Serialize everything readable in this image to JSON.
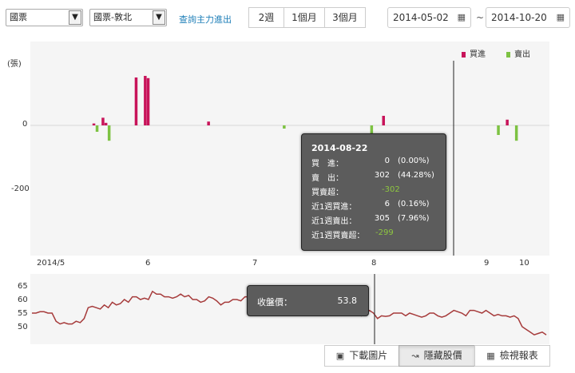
{
  "controls": {
    "market_select": "國票",
    "branch_select": "國票-敦北",
    "query_link": "查詢主力進出",
    "ranges": [
      "2週",
      "1個月",
      "3個月"
    ],
    "start_date": "2014-05-02",
    "end_date": "2014-10-20",
    "tilde": "~"
  },
  "chart_data": [
    {
      "type": "bar",
      "ylabel": "(張)",
      "ylim": [
        -350,
        90
      ],
      "yticks": [
        0,
        -200
      ],
      "xticks": [
        "2014/5",
        "6",
        "7",
        "8",
        "9",
        "10"
      ],
      "legend": {
        "position": "top-right",
        "items": [
          {
            "name": "買進",
            "color": "#c8145a"
          },
          {
            "name": "賣出",
            "color": "#7dc242"
          }
        ]
      },
      "series": [
        {
          "name": "買進",
          "color": "#c8145a",
          "values": [
            {
              "x": "2014-05-23",
              "y": 6
            },
            {
              "x": "2014-05-26",
              "y": 24
            },
            {
              "x": "2014-05-27",
              "y": 8
            },
            {
              "x": "2014-06-06",
              "y": 150
            },
            {
              "x": "2014-06-09",
              "y": 155
            },
            {
              "x": "2014-06-10",
              "y": 148
            },
            {
              "x": "2014-06-30",
              "y": 12
            },
            {
              "x": "2014-08-27",
              "y": 30
            },
            {
              "x": "2014-10-07",
              "y": 18
            }
          ]
        },
        {
          "name": "賣出",
          "color": "#7dc242",
          "values": [
            {
              "x": "2014-05-23",
              "y": -20
            },
            {
              "x": "2014-05-27",
              "y": -48
            },
            {
              "x": "2014-07-24",
              "y": -10
            },
            {
              "x": "2014-08-22",
              "y": -302
            },
            {
              "x": "2014-10-03",
              "y": -30
            },
            {
              "x": "2014-10-09",
              "y": -48
            }
          ]
        }
      ]
    },
    {
      "type": "line",
      "yticks": [
        65,
        60,
        55,
        50
      ],
      "ylim": [
        46,
        67
      ],
      "series": [
        {
          "name": "收盤價",
          "color": "#a63b3b",
          "values": [
            55,
            55,
            55.5,
            55.5,
            55,
            55,
            52,
            51,
            51.5,
            51,
            51,
            52,
            51.5,
            53,
            57,
            57.5,
            57,
            56.5,
            58,
            57,
            59,
            58,
            58.5,
            60,
            59,
            61,
            61,
            60,
            60.5,
            60,
            63,
            62,
            62,
            61,
            61,
            60.5,
            61,
            62,
            61,
            61.5,
            60,
            60,
            59,
            59.5,
            61,
            60.5,
            59.5,
            58,
            59,
            59,
            60,
            60,
            59.5,
            61,
            61,
            61,
            60,
            60,
            61,
            61,
            60,
            59,
            61,
            60.5,
            60,
            59.5,
            61,
            60,
            62,
            61,
            61.5,
            61,
            59,
            59,
            58,
            60,
            59,
            57,
            56.5,
            58,
            57,
            56,
            54,
            55,
            56,
            55,
            53,
            54,
            53.8,
            54,
            55,
            55,
            55,
            54,
            55,
            54.5,
            54,
            53.5,
            54,
            55,
            55,
            54,
            53.5,
            54,
            55,
            56,
            55.5,
            55,
            54,
            56,
            56,
            55.5,
            55,
            56,
            55,
            54,
            54.5,
            54,
            54,
            53.5,
            54,
            53,
            50,
            49,
            48,
            47,
            47.5,
            48,
            47
          ]
        }
      ]
    }
  ],
  "tooltip_main": {
    "date": "2014-08-22",
    "rows": [
      {
        "label": "買　進：",
        "value": "0",
        "pct": "(0.00%)"
      },
      {
        "label": "賣　出：",
        "value": "302",
        "pct": "(44.28%)"
      },
      {
        "label": "買賣超：",
        "value": "-302",
        "pct": ""
      },
      {
        "label": "近1週買進：",
        "value": "6",
        "pct": "(0.16%)"
      },
      {
        "label": "近1週賣出：",
        "value": "305",
        "pct": "(7.96%)"
      },
      {
        "label": "近1週買賣超：",
        "value": "-299",
        "pct": ""
      }
    ]
  },
  "tooltip_price": {
    "label": "收盤價：",
    "value": "53.8"
  },
  "actions": {
    "download": "下載圖片",
    "hide_price": "隱藏股價",
    "view_report": "檢視報表"
  },
  "colors": {
    "buy": "#c8145a",
    "sell": "#7dc242",
    "price_line": "#a63b3b",
    "link": "#1f7fb8"
  }
}
